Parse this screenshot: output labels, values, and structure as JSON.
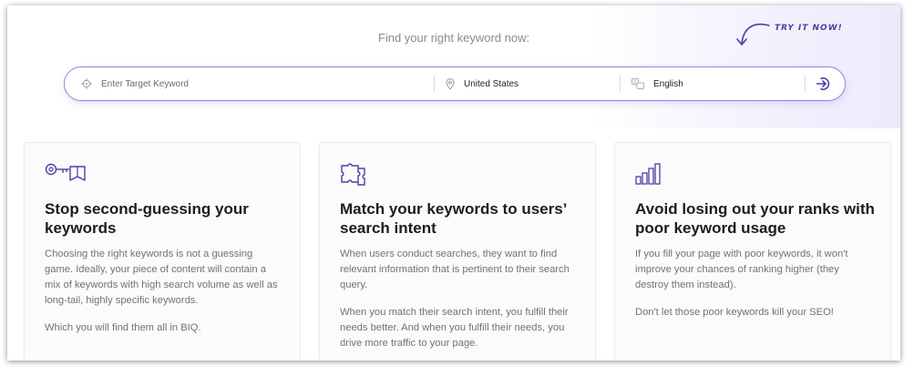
{
  "hero": {
    "tagline": "Find your right keyword now:",
    "try_now": "TRY IT NOW!"
  },
  "search": {
    "keyword_placeholder": "Enter Target Keyword",
    "keyword_value": "",
    "location_value": "United States",
    "language_value": "English",
    "icons": {
      "keyword": "target-icon",
      "location": "location-pin-icon",
      "language": "translate-icon",
      "submit": "arrow-login-icon"
    }
  },
  "cards": [
    {
      "icon": "key-icon",
      "title": "Stop second-guessing your keywords",
      "paragraphs": [
        "Choosing the right keywords is not a guessing game. Ideally, your piece of content will contain a mix of keywords with high search volume as well as long-tail, highly specific keywords.",
        "Which you will find them all in BIQ."
      ]
    },
    {
      "icon": "puzzle-icon",
      "title": "Match your keywords to users’ search intent",
      "paragraphs": [
        "When users conduct searches, they want to find relevant information that is pertinent to their search query.",
        "When you match their search intent, you fulfill their needs better. And when you fulfill their needs, you drive more traffic to your page."
      ]
    },
    {
      "icon": "bar-chart-icon",
      "title": "Avoid losing out your ranks with poor keyword usage",
      "paragraphs": [
        "If you fill your page with poor keywords, it won't improve your chances of ranking higher (they destroy them instead).",
        "Don't let those poor keywords kill your SEO!"
      ]
    }
  ],
  "colors": {
    "accent": "#5a4fcf",
    "border": "#8f84e0",
    "muted_text": "#727272"
  }
}
